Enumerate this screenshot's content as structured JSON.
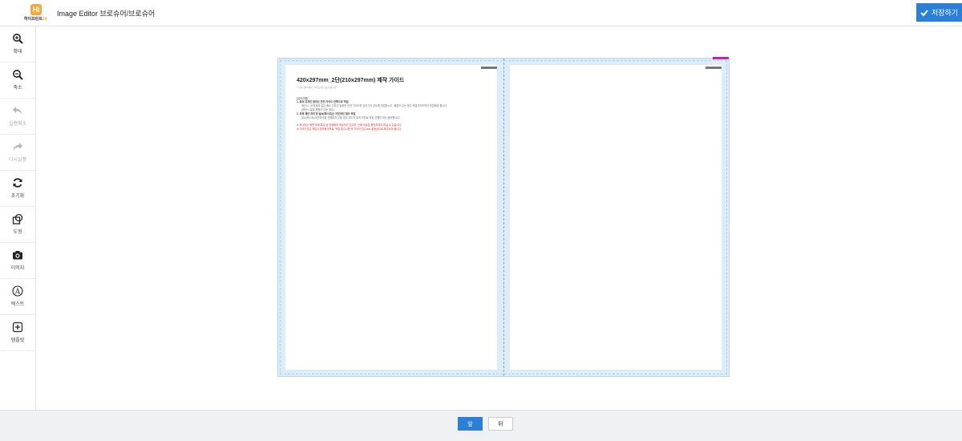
{
  "header": {
    "logo_mark": "Hi",
    "logo_text_main": "하이프린트",
    "logo_text_accent": "24",
    "title": "Image Editor 브로슈어/브로슈어",
    "save_label": "저장하기"
  },
  "sidebar": {
    "tools": [
      {
        "label": "확대",
        "icon": "zoom-in-icon"
      },
      {
        "label": "축소",
        "icon": "zoom-out-icon"
      },
      {
        "label": "실행취소",
        "icon": "undo-icon"
      },
      {
        "label": "다시실행",
        "icon": "redo-icon"
      },
      {
        "label": "초기화",
        "icon": "refresh-icon"
      },
      {
        "label": "도형",
        "icon": "shape-icon"
      },
      {
        "label": "이미지",
        "icon": "camera-icon"
      },
      {
        "label": "텍스트",
        "icon": "text-icon"
      },
      {
        "label": "템플릿",
        "icon": "template-icon"
      }
    ]
  },
  "guide": {
    "title": "420x297mm_2단(210x297mm) 제작 가이드",
    "subtitle": "* 인쇄 영역 예시 가이드라인 표시됩니다.",
    "section": "[유의사항]",
    "item1": "1. 중요 디자인 범위는 안전 가이드 안쪽으로 작업",
    "item1_desc1": "재단시, 내·외곽과 같은 중요 디자인 범위를 안전 가이드를 넘어가지 않도록 작업하시고, 배경이 있는 경우 작업사이즈까지 작업해야 합니다.",
    "item1_desc2": "(재단시 잘릴 위험이 있는 경우)",
    "item2": "2. 외곽 재단 처리 한 글씨(텍스트)는 아웃라인 필수 작업",
    "item2_desc": "글씨(텍스트)아웃라인을 진행하지 않을 경우 이미지 위치 오류로 작업 진행이 되는 불가합니다.",
    "warn1": "※ 모니터는 화면 조정 특성 상 인쇄물과 색상차이 있으며, 인쇄 색상은 확인하셔야 하실 수 있습니다.",
    "warn2": "※ 가이드선은 작업시 참조용이므로, 작업 접수시엔 꼭 가이드선은 non-발동상으로 해주셔야 됩니다."
  },
  "footer": {
    "front_label": "앞",
    "back_label": "뒤"
  }
}
